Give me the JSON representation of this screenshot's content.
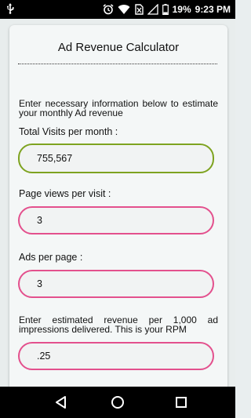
{
  "status_bar": {
    "battery_percent": "19%",
    "time": "9:23 PM",
    "icons": [
      "usb-icon",
      "alarm-icon",
      "wifi-icon",
      "no-sim-icon",
      "signal-icon",
      "battery-icon"
    ]
  },
  "calculator": {
    "title": "Ad Revenue Calculator",
    "intro": "Enter necessary information below to estimate your monthly Ad revenue",
    "fields": [
      {
        "label": "Total Visits per month :",
        "value": "755,567"
      },
      {
        "label": "Page views per visit :",
        "value": "3"
      },
      {
        "label": "Ads per page :",
        "value": "3"
      },
      {
        "label": "Enter estimated revenue per 1,000 ad impressions delivered. This is your RPM",
        "value": ".25"
      }
    ]
  },
  "nav_bar": {
    "icons": [
      "back-icon",
      "home-icon",
      "recents-icon"
    ]
  },
  "colors": {
    "focused_border": "#7ea320",
    "field_border": "#e3508d",
    "card_background": "#f4f7f7"
  }
}
